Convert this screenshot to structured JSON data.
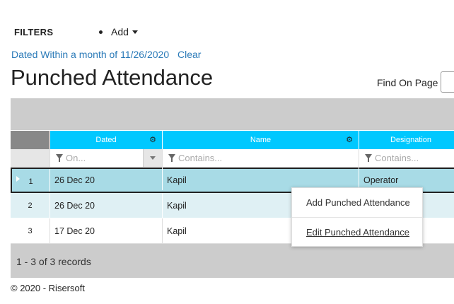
{
  "filters": {
    "label": "FILTERS",
    "add_label": "Add",
    "active_filter": "Dated Within a month of 11/26/2020",
    "clear_label": "Clear"
  },
  "page": {
    "title": "Punched Attendance",
    "find_label": "Find On Page",
    "find_value": ""
  },
  "grid": {
    "columns": [
      {
        "label": "Dated",
        "filter_placeholder": "On...",
        "has_settings": true
      },
      {
        "label": "Name",
        "filter_placeholder": "Contains...",
        "has_settings": true
      },
      {
        "label": "Designation",
        "filter_placeholder": "Contains...",
        "has_settings": false
      }
    ],
    "rows": [
      {
        "num": "1",
        "dated": "26 Dec 20",
        "name": "Kapil",
        "designation": "Operator"
      },
      {
        "num": "2",
        "dated": "26 Dec 20",
        "name": "Kapil",
        "designation": ""
      },
      {
        "num": "3",
        "dated": "17 Dec 20",
        "name": "Kapil",
        "designation": ""
      }
    ],
    "record_count": "1 - 3 of 3 records"
  },
  "context_menu": {
    "items": [
      "Add Punched Attendance",
      "Edit Punched Attendance"
    ]
  },
  "footer": {
    "copyright": "© 2020 - Risersoft"
  },
  "colors": {
    "header_bg": "#00c8ff",
    "selected_row": "#a8dbe6",
    "alt_row": "#dff0f4",
    "link": "#2a7ab8"
  }
}
